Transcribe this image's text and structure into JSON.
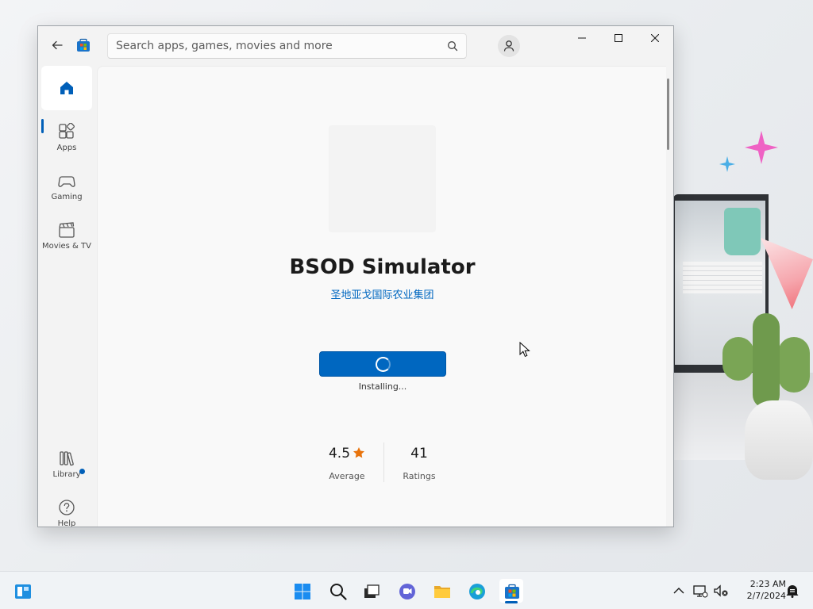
{
  "search": {
    "placeholder": "Search apps, games, movies and more"
  },
  "sidebar": {
    "items": [
      {
        "id": "home",
        "label": ""
      },
      {
        "id": "apps",
        "label": "Apps"
      },
      {
        "id": "gaming",
        "label": "Gaming"
      },
      {
        "id": "movies",
        "label": "Movies & TV"
      },
      {
        "id": "library",
        "label": "Library"
      },
      {
        "id": "help",
        "label": "Help"
      }
    ]
  },
  "app": {
    "title": "BSOD Simulator",
    "publisher": "圣地亚戈国际农业集团",
    "install_status": "Installing...",
    "rating": {
      "value": "4.5",
      "label": "Average"
    },
    "ratings_count": {
      "value": "41",
      "label": "Ratings"
    }
  },
  "taskbar": {
    "time": "2:23 AM",
    "date": "2/7/2024"
  },
  "colors": {
    "accent": "#0067c0",
    "star": "#e8730c"
  }
}
